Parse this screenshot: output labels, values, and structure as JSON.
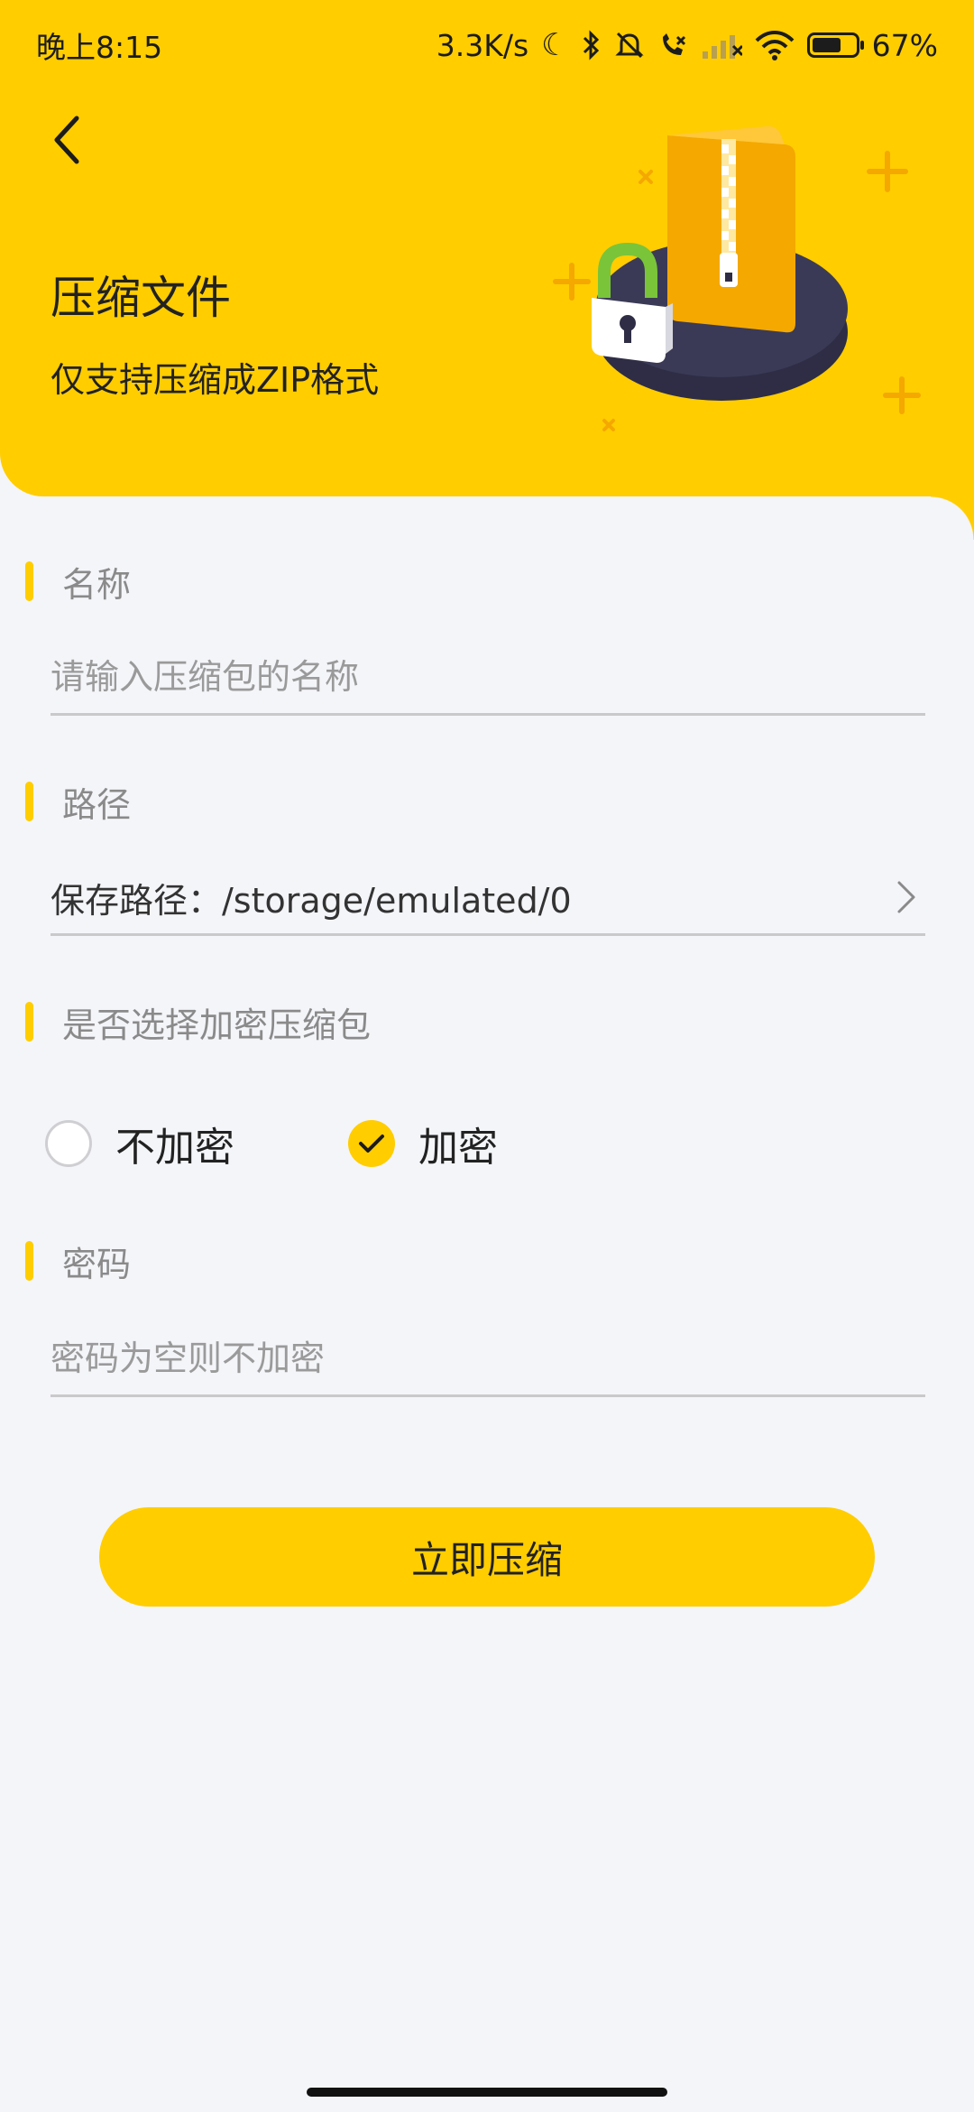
{
  "status_bar": {
    "time": "晚上8:15",
    "net_speed": "3.3K/s",
    "battery_percent": "67%"
  },
  "header": {
    "title": "压缩文件",
    "subtitle": "仅支持压缩成ZIP格式",
    "accent_color": "#ffcd00"
  },
  "form": {
    "name_section": {
      "label": "名称",
      "placeholder": "请输入压缩包的名称"
    },
    "path_section": {
      "label": "路径",
      "value": "保存路径：/storage/emulated/0"
    },
    "encrypt_section": {
      "label": "是否选择加密压缩包",
      "options": [
        {
          "label": "不加密",
          "selected": false
        },
        {
          "label": "加密",
          "selected": true
        }
      ]
    },
    "password_section": {
      "label": "密码",
      "placeholder": "密码为空则不加密"
    }
  },
  "actions": {
    "compress_label": "立即压缩"
  }
}
